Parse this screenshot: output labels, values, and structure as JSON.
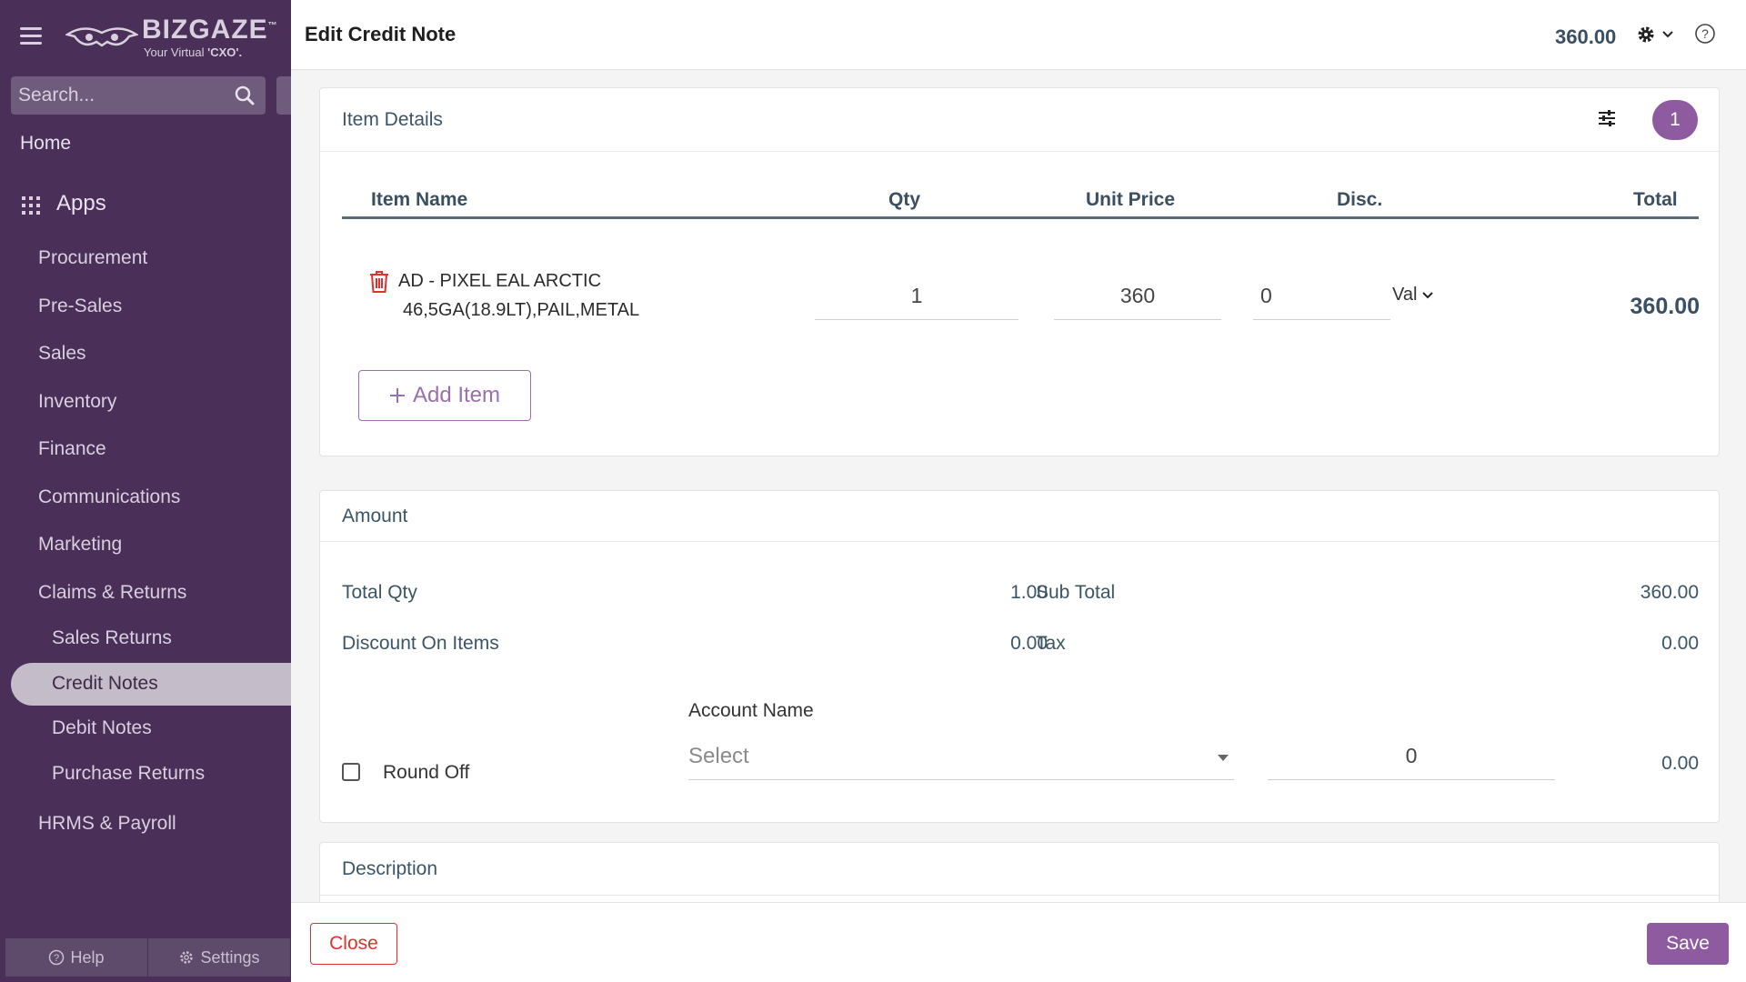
{
  "sidebar": {
    "logo": {
      "name": "BIZGAZE",
      "tm": "™",
      "tagline": "Your Virtual ",
      "tagline_bold": "'CXO'."
    },
    "search": {
      "placeholder": "Search..."
    },
    "home": "Home",
    "apps": "Apps",
    "items": [
      "Procurement",
      "Pre-Sales",
      "Sales",
      "Inventory",
      "Finance",
      "Communications",
      "Marketing",
      "Claims & Returns"
    ],
    "subitems": [
      "Sales Returns",
      "Credit Notes",
      "Debit Notes",
      "Purchase Returns"
    ],
    "active": "Credit Notes",
    "hrms": "HRMS & Payroll",
    "help": "Help",
    "settings": "Settings"
  },
  "header": {
    "title": "Edit Credit Note",
    "total": "360.00"
  },
  "item_details": {
    "title": "Item Details",
    "count": "1",
    "columns": {
      "name": "Item Name",
      "qty": "Qty",
      "unit_price": "Unit Price",
      "disc": "Disc.",
      "total": "Total"
    },
    "rows": [
      {
        "name_line1": "AD - PIXEL EAL ARCTIC",
        "name_line2": "46,5GA(18.9LT),PAIL,METAL",
        "qty": "1",
        "unit_price": "360",
        "disc": "0",
        "disc_type": "Val",
        "total": "360.00"
      }
    ],
    "add_item": "Add Item"
  },
  "amount": {
    "title": "Amount",
    "total_qty_label": "Total Qty",
    "total_qty": "1.00",
    "sub_total_label": "Sub Total",
    "sub_total": "360.00",
    "discount_label": "Discount On Items",
    "discount": "0.00",
    "tax_label": "Tax",
    "tax": "0.00",
    "round_off_label": "Round Off",
    "account_name_label": "Account Name",
    "account_placeholder": "Select",
    "round_off_value": "0",
    "round_off_amount": "0.00"
  },
  "description": {
    "title": "Description"
  },
  "footer": {
    "close": "Close",
    "save": "Save"
  },
  "colors": {
    "sidebar": "#4a2f58",
    "accent": "#8e5aa0",
    "danger": "#e1312f"
  }
}
